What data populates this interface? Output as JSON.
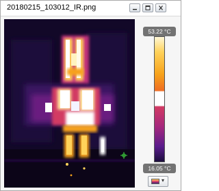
{
  "window": {
    "title": "20180215_103012_IR.png"
  },
  "legend": {
    "max_temp": "53.22 °C",
    "min_temp": "16.05 °C",
    "palette_icon": "iron-palette-icon"
  },
  "controls": {
    "minimize_icon": "minimize-icon",
    "restore_icon": "restore-icon",
    "close_icon": "close-icon"
  },
  "colors": {
    "hot": "#ffffff",
    "warm": "#f7a21a",
    "mid": "#d23a63",
    "cool": "#5a1c8c",
    "cold": "#0a0514",
    "marker": "#3ccf3c"
  }
}
